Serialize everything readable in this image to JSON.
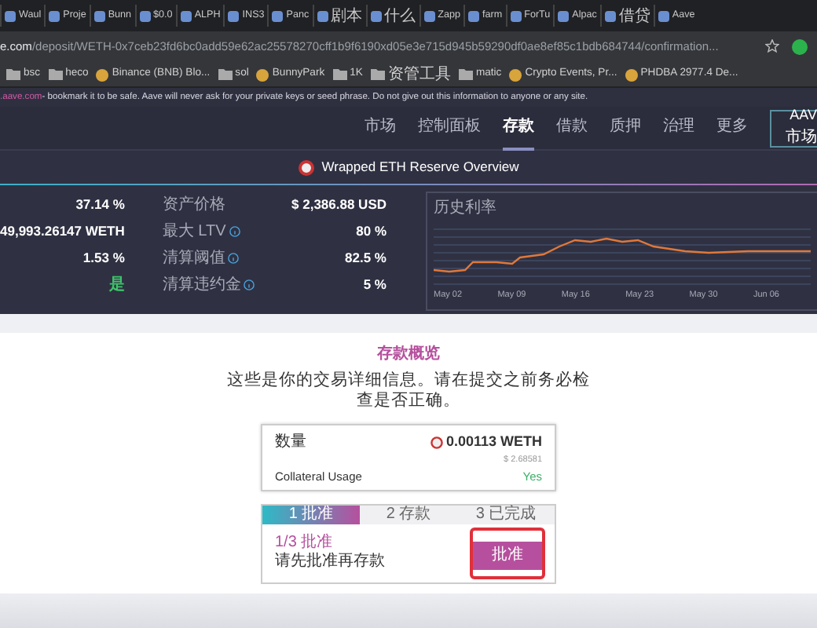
{
  "browser_tabs": [
    {
      "label": "Waul"
    },
    {
      "label": "Proje"
    },
    {
      "label": "Bunn"
    },
    {
      "label": "$0.0"
    },
    {
      "label": "ALPH"
    },
    {
      "label": "INS3"
    },
    {
      "label": "Panc"
    },
    {
      "label": "剧本"
    },
    {
      "label": "什么"
    },
    {
      "label": "Zapp"
    },
    {
      "label": "farm"
    },
    {
      "label": "ForTu"
    },
    {
      "label": "Alpac"
    },
    {
      "label": "借贷"
    },
    {
      "label": "Aave"
    }
  ],
  "address_bar": {
    "host": "e.com",
    "path": "/deposit/WETH-0x7ceb23fd6bc0add59e62ac25578270cff1b9f6190xd05e3e715d945b59290df0ae8ef85c1bdb684744/confirmation..."
  },
  "bookmarks": [
    {
      "label": "bsc",
      "kind": "folder"
    },
    {
      "label": "heco",
      "kind": "folder"
    },
    {
      "label": "Binance (BNB) Blo...",
      "kind": "site"
    },
    {
      "label": "sol",
      "kind": "folder"
    },
    {
      "label": "BunnyPark",
      "kind": "site"
    },
    {
      "label": "1K",
      "kind": "folder"
    },
    {
      "label": "资管工具",
      "kind": "folder"
    },
    {
      "label": "matic",
      "kind": "folder"
    },
    {
      "label": "Crypto Events, Pr...",
      "kind": "site"
    },
    {
      "label": "PHDBA 2977.4 De...",
      "kind": "site"
    }
  ],
  "banner": {
    "domain": ".aave.com",
    "message": "- bookmark it to be safe. Aave will never ask for your private keys or seed phrase. Do not give out this information to anyone or any site."
  },
  "nav": {
    "items": [
      {
        "label": "市场",
        "selected": false
      },
      {
        "label": "控制面板",
        "selected": false
      },
      {
        "label": "存款",
        "selected": true
      },
      {
        "label": "借款",
        "selected": false
      },
      {
        "label": "质押",
        "selected": false
      },
      {
        "label": "治理",
        "selected": false
      },
      {
        "label": "更多",
        "selected": false
      }
    ],
    "logo": "AAV",
    "logo_caption": "市场"
  },
  "reserve_overview": {
    "title": "Wrapped ETH Reserve Overview",
    "left_values": [
      {
        "value": "37.14 %",
        "positive": false
      },
      {
        "value": "49,993.26147 WETH",
        "positive": false
      },
      {
        "value": "1.53 %",
        "positive": false
      },
      {
        "value": "是",
        "positive": true
      }
    ],
    "stats": [
      {
        "label": "资产价格",
        "value": "$ 2,386.88 USD",
        "info": false
      },
      {
        "label": "最大 LTV",
        "value": "80 %",
        "info": true
      },
      {
        "label": "清算阈值",
        "value": "82.5 %",
        "info": true
      },
      {
        "label": "清算违约金",
        "value": "5 %",
        "info": true
      }
    ],
    "chart": {
      "title": "历史利率",
      "x_labels": [
        "May 02",
        "May 09",
        "May 16",
        "May 23",
        "May 30",
        "Jun 06"
      ]
    }
  },
  "deposit_overview": {
    "title": "存款概览",
    "description": "这些是你的交易详细信息。请在提交之前务必检查是否正确。",
    "amount_label": "数量",
    "amount": "0.00113 WETH",
    "amount_usd": "$ 2.68581",
    "collateral_label": "Collateral Usage",
    "collateral_value": "Yes"
  },
  "steps": [
    {
      "label": "1 批准",
      "selected": true
    },
    {
      "label": "2 存款",
      "selected": false
    },
    {
      "label": "3 已完成",
      "selected": false
    }
  ],
  "current_step": {
    "title": "1/3 批准",
    "hint": "请先批准再存款",
    "button": "批准"
  }
}
